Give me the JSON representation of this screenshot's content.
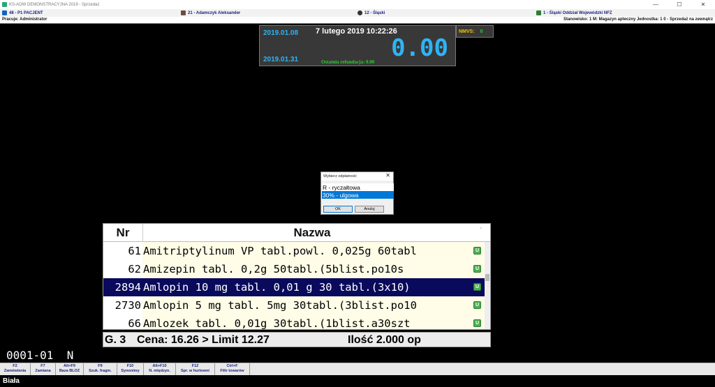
{
  "window": {
    "title": "KS-AOW DEMONSTRACYJNA 2019 - Sprzedaż",
    "minimize": "—",
    "maximize": "☐",
    "close": "✕"
  },
  "infobar": {
    "patient": "48 - P1 PACJENT",
    "doctor": "21 - Adamczyk Aleksander",
    "region": "12 - Śląski",
    "nfz": "1 - Śląski Oddział Wojewódzki NFZ"
  },
  "statusbar": {
    "user": "Pracuje: Administrator",
    "station": "Stanowisko: 1   M: Magazyn apteczny   Jednostka: 1   0 - Sprzedaż na zewnątrz"
  },
  "clock": {
    "date_from": "2019.01.08",
    "date_to": "2019.01.31",
    "datetime": "7 lutego 2019   10:22:26",
    "amount": "0.00",
    "refund": "Ostatnia refundacja: 0.00"
  },
  "nmvs": {
    "label": "NMVS:",
    "value": "0"
  },
  "dialog": {
    "title": "Wybierz odpłatność",
    "close": "✕",
    "options": [
      "R - ryczałtowa",
      "30% - ulgowa"
    ],
    "ok": "OK",
    "cancel": "Anuluj"
  },
  "grid": {
    "columns": [
      "Nr",
      "Nazwa"
    ],
    "sort_glyph": "ˇ",
    "rows": [
      {
        "nr": "61",
        "name": "Amitriptylinum VP tabl.powl. 0,025g 60tabl",
        "flag": "U"
      },
      {
        "nr": "62",
        "name": "Amizepin tabl. 0,2g 50tabl.(5blist.po10s",
        "flag": "U"
      },
      {
        "nr": "2894",
        "name": "Amlopin 10 mg tabl. 0,01 g 30 tabl.(3x10)",
        "flag": "U"
      },
      {
        "nr": "2730",
        "name": "Amlopin 5 mg tabl. 5mg 30tabl.(3blist.po10",
        "flag": "U"
      },
      {
        "nr": "66",
        "name": "Amlozek tabl. 0,01g 30tabl.(1blist.a30szt",
        "flag": "U"
      }
    ]
  },
  "infoline": {
    "group": "G. 3",
    "price": "Cena: 16.26 > Limit 12.27",
    "qty": "Ilość 2.000 op"
  },
  "doc_code": "0001-01  N",
  "fkeys": [
    {
      "key": "F2",
      "label": "Zamówienia"
    },
    {
      "key": "F7",
      "label": "Zamiana"
    },
    {
      "key": "Alt+F9",
      "label": "Baza BLOZ"
    },
    {
      "key": "F9",
      "label": "Szuk. fragm."
    },
    {
      "key": "F10",
      "label": "Synonimy"
    },
    {
      "key": "Alt+F10",
      "label": "N. międzyn."
    },
    {
      "key": "F12",
      "label": "Spr. w hurtowni"
    },
    {
      "key": "Ctrl+F",
      "label": "Filtr towarów"
    }
  ],
  "bottom_label": "Biała",
  "colors": {
    "selected_row": "#0a0a5c",
    "amount_blue": "#2fb3f4",
    "refund_green": "#2ecc2e",
    "dialog_highlight": "#0078d7"
  }
}
